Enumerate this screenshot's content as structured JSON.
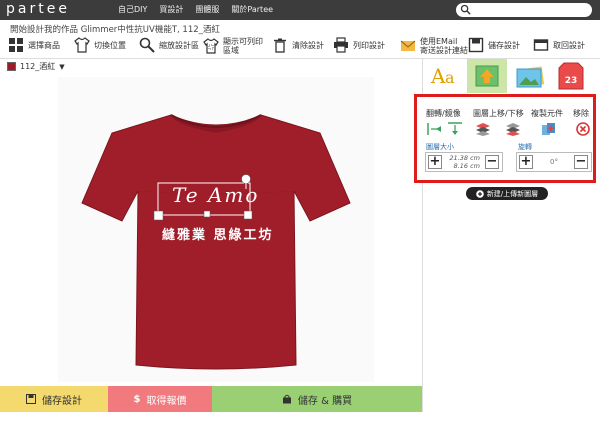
{
  "brand": "partee",
  "nav": [
    "自己DIY",
    "買設計",
    "團體服",
    "關於Partee"
  ],
  "search": {
    "value": "",
    "placeholder": ""
  },
  "page_title": "開始設計我的作品 Glimmer中性抗UV機能T, 112_酒紅",
  "toolbar": {
    "select_product": "選擇商品",
    "switch_position": "切換位置",
    "zoom_design": "縮放設計區",
    "show_print_area": "顯示可列印區域",
    "clear_design": "清除設計",
    "print_design": "列印設計",
    "email_link_1": "使用EMail",
    "email_link_2": "寄送設計連結",
    "save_design": "儲存設計",
    "back_to_design": "取回設計"
  },
  "color_select": {
    "label": "112_酒紅",
    "swatch": "#9c1c2a"
  },
  "design": {
    "handwriting": "Te Amo",
    "caption": "縫雅業 思綠工坊"
  },
  "panel": {
    "flip_label": "翻轉/鏡像",
    "layer_label": "圖層上移/下移",
    "duplicate_label": "複製元件",
    "remove_label": "移除",
    "size_label": "圖層大小",
    "width_value": "21.38 cm",
    "height_value": "8.16 cm",
    "rotate_label": "旋轉",
    "rotate_value": "0°"
  },
  "new_layer_button": "新建/上傳新圖層",
  "bottom": {
    "save": "儲存設計",
    "quote": "取得報價",
    "buy": "儲存 & 購買"
  },
  "colors": {
    "shirt": "#a01e2a",
    "highlight": "#e01b1b",
    "save_bg": "#f3d96e",
    "quote_bg": "#f07a7e",
    "buy_bg": "#9ad073"
  }
}
